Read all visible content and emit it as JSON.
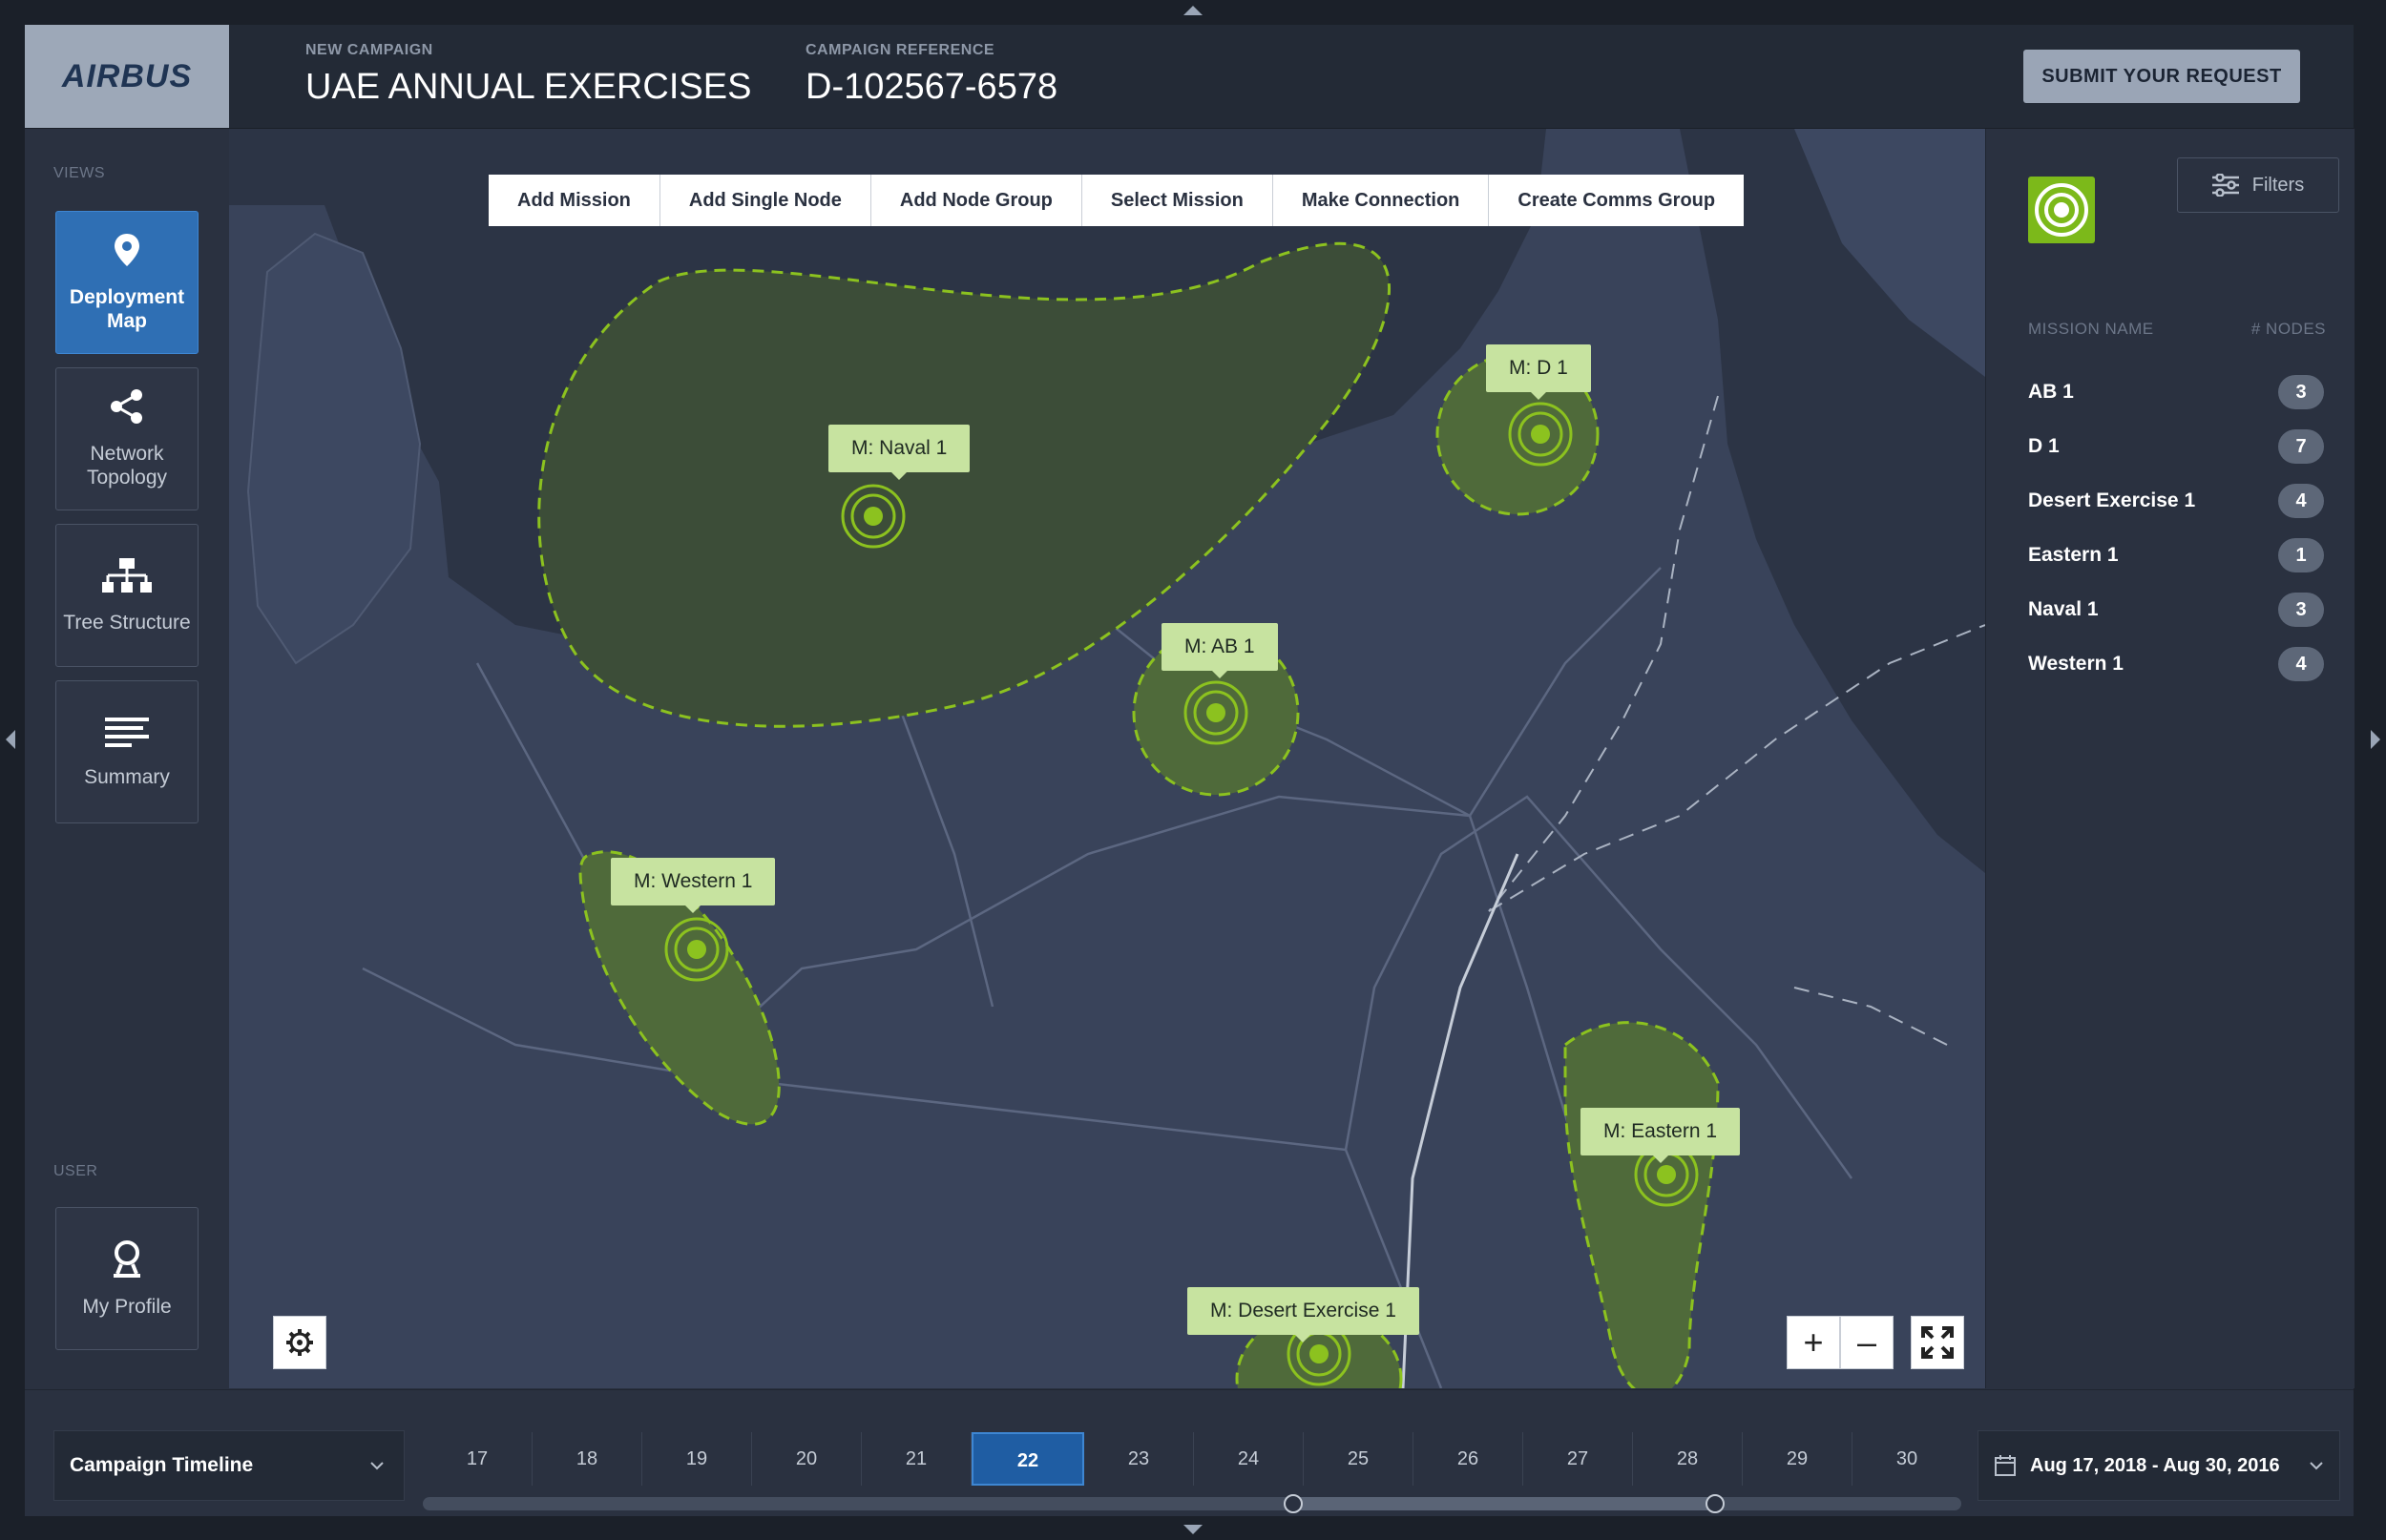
{
  "header": {
    "logo": "AIRBUS",
    "campaign_label": "NEW CAMPAIGN",
    "campaign_name": "UAE ANNUAL EXERCISES",
    "reference_label": "CAMPAIGN REFERENCE",
    "reference_value": "D-102567-6578",
    "submit_label": "SUBMIT YOUR REQUEST"
  },
  "sidebar": {
    "views_label": "VIEWS",
    "views": [
      {
        "label": "Deployment Map",
        "icon": "map-pin-icon",
        "active": true
      },
      {
        "label": "Network Topology",
        "icon": "share-icon",
        "active": false
      },
      {
        "label": "Tree Structure",
        "icon": "hierarchy-icon",
        "active": false
      },
      {
        "label": "Summary",
        "icon": "lines-icon",
        "active": false
      }
    ],
    "user_label": "USER",
    "profile_label": "My Profile"
  },
  "toolbar": {
    "items": [
      "Add Mission",
      "Add Single Node",
      "Add Node Group",
      "Select Mission",
      "Make Connection",
      "Create Comms Group"
    ]
  },
  "map": {
    "missions": [
      {
        "label": "M: Naval 1"
      },
      {
        "label": "M: D 1"
      },
      {
        "label": "M: AB 1"
      },
      {
        "label": "M: Western 1"
      },
      {
        "label": "M: Eastern 1"
      },
      {
        "label": "M: Desert Exercise 1"
      }
    ],
    "zoom_in": "+",
    "zoom_out": "–"
  },
  "right_panel": {
    "filters_label": "Filters",
    "col_mission": "MISSION NAME",
    "col_nodes": "# NODES",
    "rows": [
      {
        "name": "AB 1",
        "nodes": "3"
      },
      {
        "name": "D 1",
        "nodes": "7"
      },
      {
        "name": "Desert Exercise 1",
        "nodes": "4"
      },
      {
        "name": "Eastern 1",
        "nodes": "1"
      },
      {
        "name": "Naval 1",
        "nodes": "3"
      },
      {
        "name": "Western 1",
        "nodes": "4"
      }
    ]
  },
  "timeline": {
    "label": "Campaign Timeline",
    "days": [
      "17",
      "18",
      "19",
      "20",
      "21",
      "22",
      "23",
      "24",
      "25",
      "26",
      "27",
      "28",
      "29",
      "30"
    ],
    "selected_day": "22",
    "date_range": "Aug 17, 2018 - Aug 30, 2016"
  },
  "colors": {
    "accent_blue": "#2f6fb4",
    "mission_green": "#8cc21f",
    "label_green": "#c7e3a0"
  }
}
